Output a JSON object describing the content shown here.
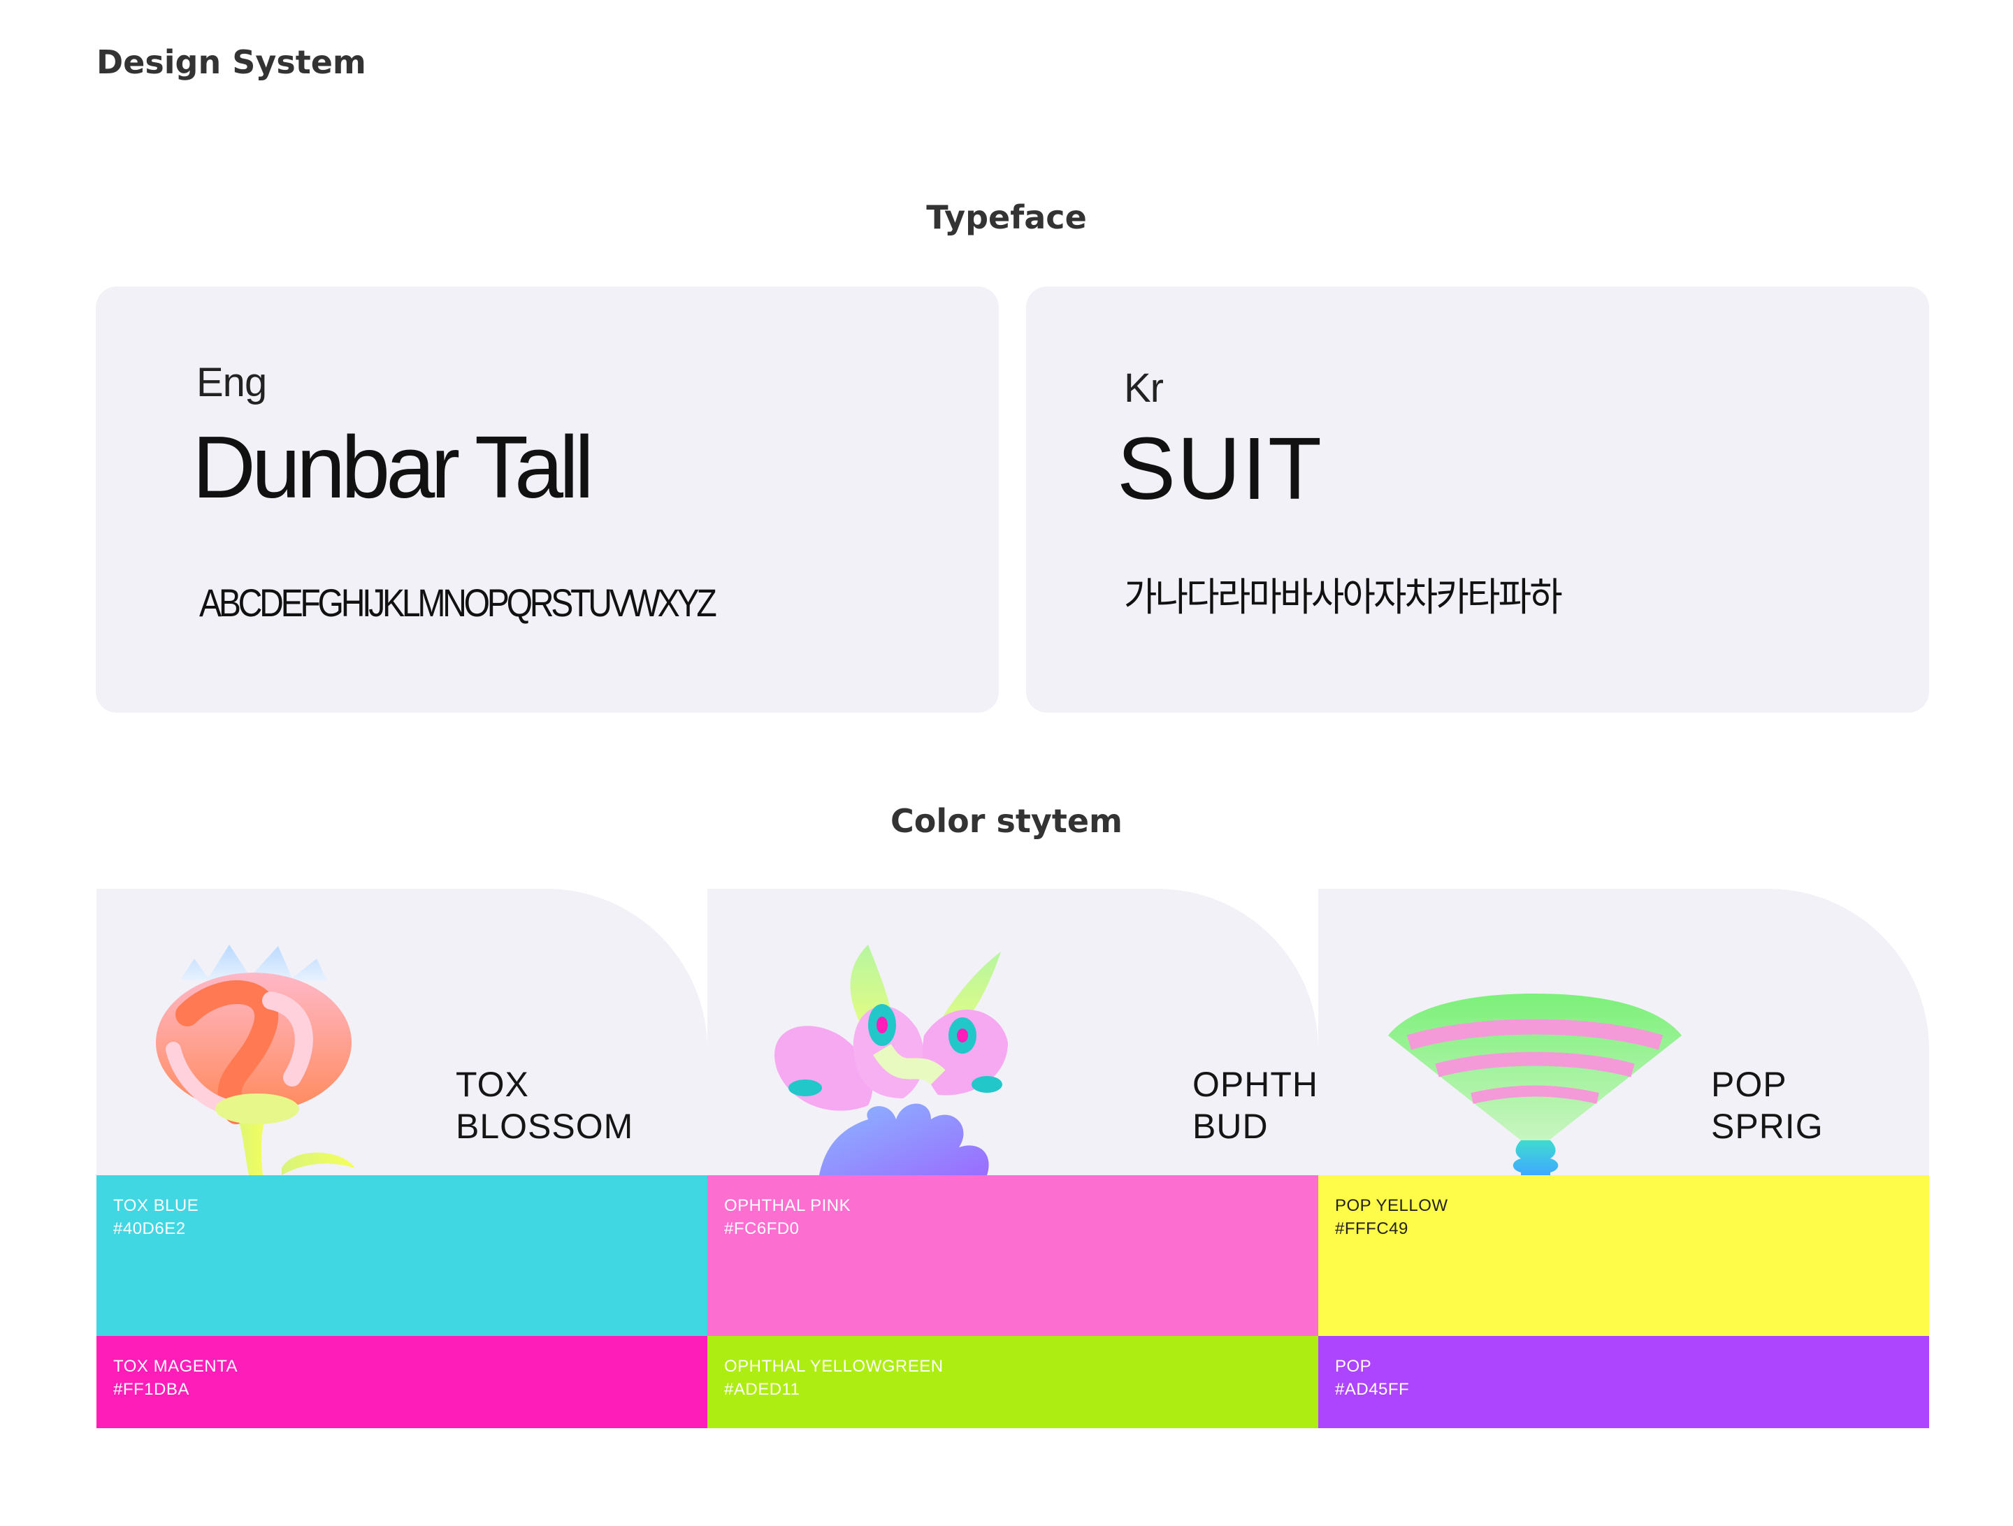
{
  "page_title": "Design System",
  "typeface": {
    "section_title": "Typeface",
    "eng": {
      "lang": "Eng",
      "name": "Dunbar Tall",
      "sample": "ABCDEFGHIJKLMNOPQRSTUVWXYZ"
    },
    "kr": {
      "lang": "Kr",
      "name": "SUIT",
      "sample": "가나다라마바사아자차카타파하"
    }
  },
  "color_system": {
    "section_title": "Color stytem",
    "columns": [
      {
        "name": "TOX\nBLOSSOM",
        "illustration": "blossom-flower",
        "primary": {
          "label": "TOX BLUE",
          "hex": "#40D6E2",
          "text_color": "#ffffff"
        },
        "secondary": {
          "label": "TOX MAGENTA",
          "hex": "#FF1DBA",
          "text_color": "#ffffff"
        }
      },
      {
        "name": "OPHTHAL\nBUD",
        "illustration": "bud-flower",
        "primary": {
          "label": "OPHTHAL PINK",
          "hex": "#FC6FD0",
          "text_color": "#ffffff"
        },
        "secondary": {
          "label": "OPHTHAL YELLOWGREEN",
          "hex": "#ADED11",
          "text_color": "#ffffff"
        }
      },
      {
        "name": "POP\nSPRIG",
        "illustration": "sprig-fan",
        "primary": {
          "label": "POP YELLOW",
          "hex": "#FFFC49",
          "text_color": "#222222"
        },
        "secondary": {
          "label": "POP",
          "hex": "#AD45FF",
          "text_color": "#ffffff"
        }
      }
    ]
  }
}
